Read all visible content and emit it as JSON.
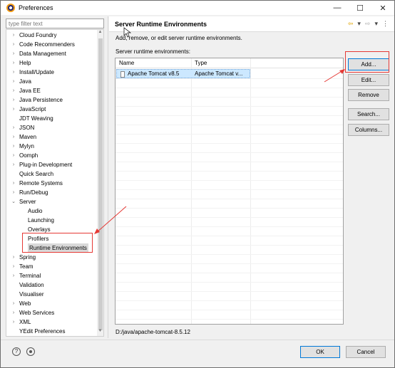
{
  "window": {
    "title": "Preferences",
    "controls": {
      "minimize": "—",
      "maximize": "☐",
      "close": "✕"
    }
  },
  "filter": {
    "placeholder": "type filter text"
  },
  "tree": [
    {
      "label": "Cloud Foundry",
      "expander": "›"
    },
    {
      "label": "Code Recommenders",
      "expander": "›"
    },
    {
      "label": "Data Management",
      "expander": "›"
    },
    {
      "label": "Help",
      "expander": "›"
    },
    {
      "label": "Install/Update",
      "expander": "›"
    },
    {
      "label": "Java",
      "expander": "›"
    },
    {
      "label": "Java EE",
      "expander": "›"
    },
    {
      "label": "Java Persistence",
      "expander": "›"
    },
    {
      "label": "JavaScript",
      "expander": "›"
    },
    {
      "label": "JDT Weaving",
      "expander": ""
    },
    {
      "label": "JSON",
      "expander": "›"
    },
    {
      "label": "Maven",
      "expander": "›"
    },
    {
      "label": "Mylyn",
      "expander": "›"
    },
    {
      "label": "Oomph",
      "expander": "›"
    },
    {
      "label": "Plug-in Development",
      "expander": "›"
    },
    {
      "label": "Quick Search",
      "expander": ""
    },
    {
      "label": "Remote Systems",
      "expander": "›"
    },
    {
      "label": "Run/Debug",
      "expander": "›"
    },
    {
      "label": "Server",
      "expander": "⌄"
    },
    {
      "label": "Audio",
      "expander": ""
    },
    {
      "label": "Launching",
      "expander": ""
    },
    {
      "label": "Overlays",
      "expander": ""
    },
    {
      "label": "Profilers",
      "expander": ""
    },
    {
      "label": "Runtime Environments",
      "expander": ""
    },
    {
      "label": "Spring",
      "expander": "›"
    },
    {
      "label": "Team",
      "expander": "›"
    },
    {
      "label": "Terminal",
      "expander": "›"
    },
    {
      "label": "Validation",
      "expander": ""
    },
    {
      "label": "Visualiser",
      "expander": ""
    },
    {
      "label": "Web",
      "expander": "›"
    },
    {
      "label": "Web Services",
      "expander": "›"
    },
    {
      "label": "XML",
      "expander": "›"
    },
    {
      "label": "YEdit Preferences",
      "expander": ""
    }
  ],
  "page": {
    "title": "Server Runtime Environments",
    "nav": {
      "back": "⇦",
      "back_menu": "▾",
      "forward": "⇨",
      "forward_menu": "▾",
      "view_menu": "⋮"
    },
    "description": "Add, remove, or edit server runtime environments.",
    "list_label": "Server runtime environments:",
    "columns": [
      "Name",
      "Type"
    ],
    "rows": [
      {
        "name": "Apache Tomcat v8.5",
        "type": "Apache Tomcat v..."
      }
    ],
    "location": "D:/java/apache-tomcat-8.5.12"
  },
  "buttons": {
    "add": "Add...",
    "edit": "Edit...",
    "remove": "Remove",
    "search": "Search...",
    "columns": "Columns..."
  },
  "footer": {
    "help": "?",
    "ok": "OK",
    "cancel": "Cancel"
  },
  "colors": {
    "annotation": "#e53935",
    "selection": "#cce8ff",
    "focus_border": "#0078d7"
  }
}
